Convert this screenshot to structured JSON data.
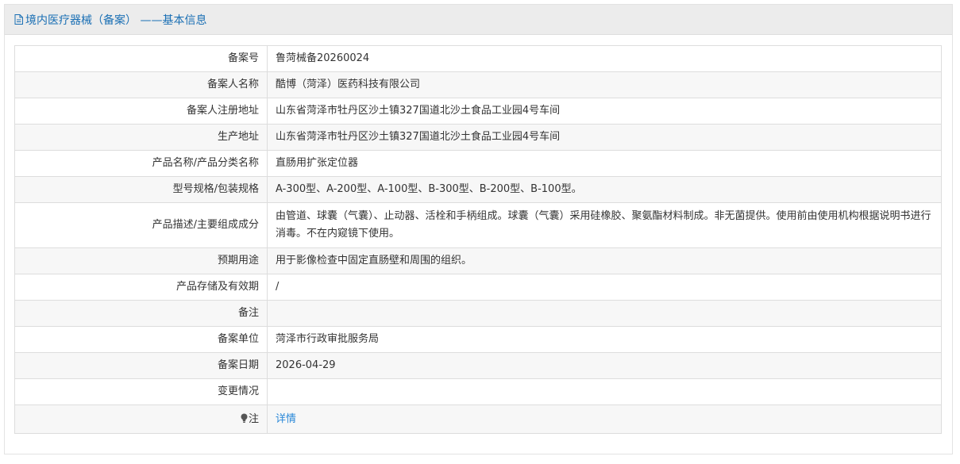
{
  "header": {
    "title": "境内医疗器械（备案） ——基本信息",
    "icon": "document-icon"
  },
  "rows": [
    {
      "label": "备案号",
      "value": "鲁菏械备20260024"
    },
    {
      "label": "备案人名称",
      "value": "酷博（菏泽）医药科技有限公司"
    },
    {
      "label": "备案人注册地址",
      "value": "山东省菏泽市牡丹区沙土镇327国道北沙土食品工业园4号车间"
    },
    {
      "label": "生产地址",
      "value": "山东省菏泽市牡丹区沙土镇327国道北沙土食品工业园4号车间"
    },
    {
      "label": "产品名称/产品分类名称",
      "value": "直肠用扩张定位器"
    },
    {
      "label": "型号规格/包装规格",
      "value": "A-300型、A-200型、A-100型、B-300型、B-200型、B-100型。"
    },
    {
      "label": "产品描述/主要组成成分",
      "value": "由管道、球囊（气囊）、止动器、活栓和手柄组成。球囊（气囊）采用硅橡胶、聚氨酯材料制成。非无菌提供。使用前由使用机构根据说明书进行消毒。不在内窥镜下使用。"
    },
    {
      "label": "预期用途",
      "value": "用于影像检查中固定直肠壁和周围的组织。"
    },
    {
      "label": "产品存储及有效期",
      "value": "/"
    },
    {
      "label": "备注",
      "value": ""
    },
    {
      "label": "备案单位",
      "value": "菏泽市行政审批服务局"
    },
    {
      "label": "备案日期",
      "value": "2026-04-29"
    },
    {
      "label": "变更情况",
      "value": ""
    }
  ],
  "note_row": {
    "icon": "lightbulb-icon",
    "label": "注",
    "link_text": "详情",
    "link_color": "#2a88d8"
  },
  "colors": {
    "title": "#1a6fb4",
    "header_bg": "#ececec",
    "stripe_bg": "#f7f7f7",
    "border": "#dddddd"
  }
}
